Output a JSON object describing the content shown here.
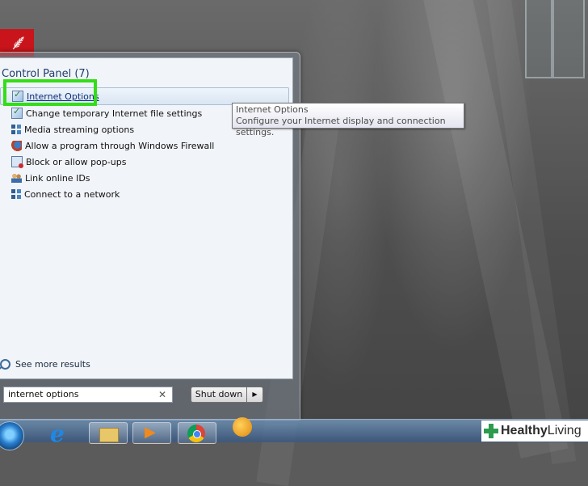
{
  "start_menu": {
    "section_header": "Control Panel (7)",
    "results": [
      {
        "label": "Internet Options",
        "icon": "internet-options-icon",
        "selected": true
      },
      {
        "label": "Change temporary Internet file settings",
        "icon": "internet-options-icon"
      },
      {
        "label": "Media streaming options",
        "icon": "network-icon"
      },
      {
        "label": "Allow a program through Windows Firewall",
        "icon": "firewall-icon"
      },
      {
        "label": "Block or allow pop-ups",
        "icon": "popup-icon"
      },
      {
        "label": "Link online IDs",
        "icon": "users-icon"
      },
      {
        "label": "Connect to a network",
        "icon": "network-icon"
      }
    ],
    "see_more": "See more results",
    "search_value": "internet options",
    "shutdown_label": "Shut down"
  },
  "tooltip": {
    "title": "Internet Options",
    "description": "Configure your Internet display and connection settings."
  },
  "taskbar": {
    "items": [
      "start-orb",
      "internet-explorer",
      "windows-explorer",
      "media-player",
      "chrome",
      "gom-player"
    ]
  },
  "watermark": {
    "part1": "Healthy",
    "part2": "Living"
  },
  "colors": {
    "highlight": "#33dd18",
    "link": "#0a2a7a",
    "header": "#1e3d6b"
  }
}
